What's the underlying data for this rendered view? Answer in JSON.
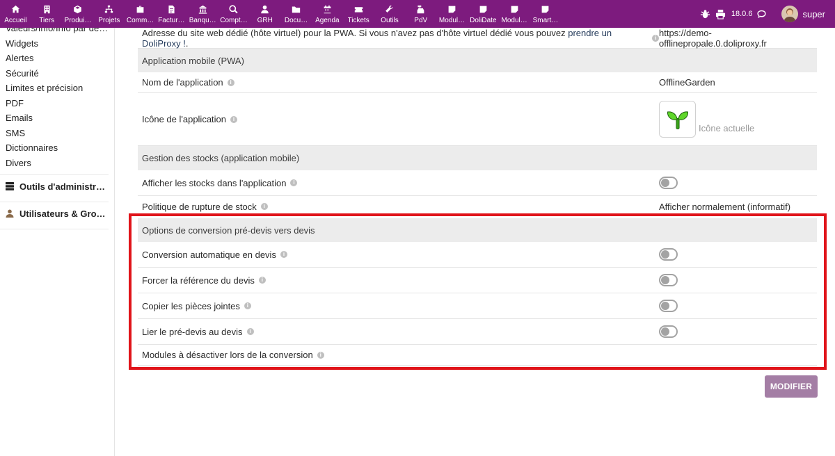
{
  "nav": [
    {
      "label": "Accueil",
      "icon": "home-icon"
    },
    {
      "label": "Tiers",
      "icon": "building-icon"
    },
    {
      "label": "Produi…",
      "icon": "cube-icon"
    },
    {
      "label": "Projets",
      "icon": "sitemap-icon"
    },
    {
      "label": "Comm…",
      "icon": "briefcase-icon"
    },
    {
      "label": "Factur…",
      "icon": "invoice-icon"
    },
    {
      "label": "Banqu…",
      "icon": "bank-icon"
    },
    {
      "label": "Compt…",
      "icon": "search-dollar-icon"
    },
    {
      "label": "GRH",
      "icon": "user-tie-icon"
    },
    {
      "label": "Docu…",
      "icon": "folder-icon"
    },
    {
      "label": "Agenda",
      "icon": "calendar-icon"
    },
    {
      "label": "Tickets",
      "icon": "ticket-icon"
    },
    {
      "label": "Outils",
      "icon": "wrench-icon"
    },
    {
      "label": "PdV",
      "icon": "cash-register-icon"
    },
    {
      "label": "Modul…",
      "icon": "module-icon"
    },
    {
      "label": "DoliDate",
      "icon": "module-icon"
    },
    {
      "label": "Modul…",
      "icon": "module-icon"
    },
    {
      "label": "Smart…",
      "icon": "module-icon"
    }
  ],
  "topright": {
    "version": "18.0.6",
    "username": "super"
  },
  "leftmenu": {
    "cut_item": "Valeurs/Info/Info par défaut",
    "items": [
      "Widgets",
      "Alertes",
      "Sécurité",
      "Limites et précision",
      "PDF",
      "Emails",
      "SMS",
      "Dictionnaires",
      "Divers"
    ],
    "sections": [
      "Outils d'administration",
      "Utilisateurs & Groupes"
    ]
  },
  "main": {
    "pwa_url_label_part1": "Adresse du site web dédié (hôte virtuel) pour la PWA. Si vous n'avez pas d'hôte virtuel dédié vous pouvez ",
    "pwa_url_link": "prendre un DoliProxy !",
    "pwa_url_label_part2": ".",
    "pwa_url_value": "https://demo-offlinepropale.0.doliproxy.fr",
    "section_pwa": "Application mobile (PWA)",
    "app_name_label": "Nom de l'application",
    "app_name_value": "OfflineGarden",
    "app_icon_label": "Icône de l'application",
    "app_icon_caption": "Icône actuelle",
    "section_stock": "Gestion des stocks (application mobile)",
    "show_stock_label": "Afficher les stocks dans l'application",
    "stockout_policy_label": "Politique de rupture de stock",
    "stockout_policy_value": "Afficher normalement (informatif)",
    "section_conversion": "Options de conversion pré-devis vers devis",
    "auto_convert_label": "Conversion automatique en devis",
    "force_ref_label": "Forcer la référence du devis",
    "copy_attachments_label": "Copier les pièces jointes",
    "link_predevis_label": "Lier le pré-devis au devis",
    "modules_disable_label": "Modules à désactiver lors de la conversion",
    "modify_button": "MODIFIER"
  },
  "colors": {
    "topbar": "#7d1b7e",
    "highlight": "#e0141a",
    "button": "#a47ea5"
  }
}
